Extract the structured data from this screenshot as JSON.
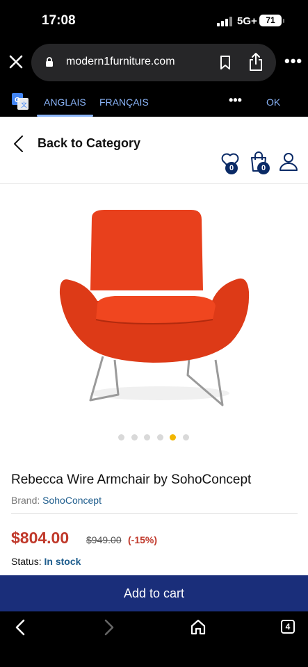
{
  "status_bar": {
    "time": "17:08",
    "network": "5G+",
    "battery": "71"
  },
  "browser": {
    "domain": "modern1furniture.com",
    "tabs_count": "4"
  },
  "translate": {
    "source_lang": "ANGLAIS",
    "target_lang": "FRANÇAIS",
    "more": "•••",
    "ok": "OK"
  },
  "header": {
    "back_label": "Back to Category",
    "wishlist_count": "0",
    "cart_count": "0"
  },
  "product": {
    "title": "Rebecca Wire Armchair by SohoConcept",
    "brand_label": "Brand:",
    "brand_name": "SohoConcept",
    "price": "$804.00",
    "old_price": "$949.00",
    "discount": "(-15%)",
    "status_label": "Status:",
    "status_value": "In stock",
    "image_count": 6,
    "active_image": 5
  },
  "actions": {
    "add_to_cart": "Add to cart"
  },
  "colors": {
    "accent": "#1a2e7a",
    "price": "#c0392b",
    "active_dot": "#f2b600",
    "chair": "#e8401c"
  }
}
